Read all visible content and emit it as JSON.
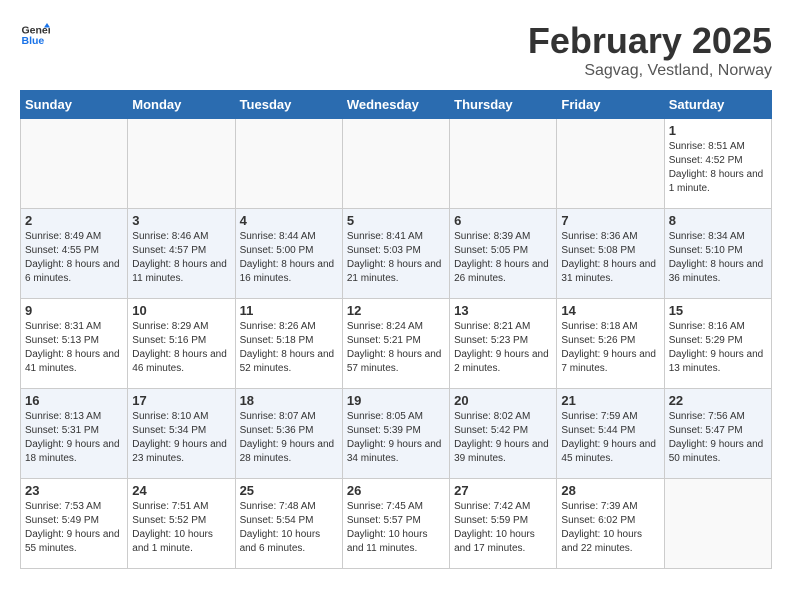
{
  "header": {
    "logo_general": "General",
    "logo_blue": "Blue",
    "title": "February 2025",
    "subtitle": "Sagvag, Vestland, Norway"
  },
  "days_of_week": [
    "Sunday",
    "Monday",
    "Tuesday",
    "Wednesday",
    "Thursday",
    "Friday",
    "Saturday"
  ],
  "weeks": [
    [
      {
        "day": "",
        "info": "",
        "empty": true
      },
      {
        "day": "",
        "info": "",
        "empty": true
      },
      {
        "day": "",
        "info": "",
        "empty": true
      },
      {
        "day": "",
        "info": "",
        "empty": true
      },
      {
        "day": "",
        "info": "",
        "empty": true
      },
      {
        "day": "",
        "info": "",
        "empty": true
      },
      {
        "day": "1",
        "info": "Sunrise: 8:51 AM\nSunset: 4:52 PM\nDaylight: 8 hours and 1 minute.",
        "empty": false
      }
    ],
    [
      {
        "day": "2",
        "info": "Sunrise: 8:49 AM\nSunset: 4:55 PM\nDaylight: 8 hours and 6 minutes.",
        "empty": false
      },
      {
        "day": "3",
        "info": "Sunrise: 8:46 AM\nSunset: 4:57 PM\nDaylight: 8 hours and 11 minutes.",
        "empty": false
      },
      {
        "day": "4",
        "info": "Sunrise: 8:44 AM\nSunset: 5:00 PM\nDaylight: 8 hours and 16 minutes.",
        "empty": false
      },
      {
        "day": "5",
        "info": "Sunrise: 8:41 AM\nSunset: 5:03 PM\nDaylight: 8 hours and 21 minutes.",
        "empty": false
      },
      {
        "day": "6",
        "info": "Sunrise: 8:39 AM\nSunset: 5:05 PM\nDaylight: 8 hours and 26 minutes.",
        "empty": false
      },
      {
        "day": "7",
        "info": "Sunrise: 8:36 AM\nSunset: 5:08 PM\nDaylight: 8 hours and 31 minutes.",
        "empty": false
      },
      {
        "day": "8",
        "info": "Sunrise: 8:34 AM\nSunset: 5:10 PM\nDaylight: 8 hours and 36 minutes.",
        "empty": false
      }
    ],
    [
      {
        "day": "9",
        "info": "Sunrise: 8:31 AM\nSunset: 5:13 PM\nDaylight: 8 hours and 41 minutes.",
        "empty": false
      },
      {
        "day": "10",
        "info": "Sunrise: 8:29 AM\nSunset: 5:16 PM\nDaylight: 8 hours and 46 minutes.",
        "empty": false
      },
      {
        "day": "11",
        "info": "Sunrise: 8:26 AM\nSunset: 5:18 PM\nDaylight: 8 hours and 52 minutes.",
        "empty": false
      },
      {
        "day": "12",
        "info": "Sunrise: 8:24 AM\nSunset: 5:21 PM\nDaylight: 8 hours and 57 minutes.",
        "empty": false
      },
      {
        "day": "13",
        "info": "Sunrise: 8:21 AM\nSunset: 5:23 PM\nDaylight: 9 hours and 2 minutes.",
        "empty": false
      },
      {
        "day": "14",
        "info": "Sunrise: 8:18 AM\nSunset: 5:26 PM\nDaylight: 9 hours and 7 minutes.",
        "empty": false
      },
      {
        "day": "15",
        "info": "Sunrise: 8:16 AM\nSunset: 5:29 PM\nDaylight: 9 hours and 13 minutes.",
        "empty": false
      }
    ],
    [
      {
        "day": "16",
        "info": "Sunrise: 8:13 AM\nSunset: 5:31 PM\nDaylight: 9 hours and 18 minutes.",
        "empty": false
      },
      {
        "day": "17",
        "info": "Sunrise: 8:10 AM\nSunset: 5:34 PM\nDaylight: 9 hours and 23 minutes.",
        "empty": false
      },
      {
        "day": "18",
        "info": "Sunrise: 8:07 AM\nSunset: 5:36 PM\nDaylight: 9 hours and 28 minutes.",
        "empty": false
      },
      {
        "day": "19",
        "info": "Sunrise: 8:05 AM\nSunset: 5:39 PM\nDaylight: 9 hours and 34 minutes.",
        "empty": false
      },
      {
        "day": "20",
        "info": "Sunrise: 8:02 AM\nSunset: 5:42 PM\nDaylight: 9 hours and 39 minutes.",
        "empty": false
      },
      {
        "day": "21",
        "info": "Sunrise: 7:59 AM\nSunset: 5:44 PM\nDaylight: 9 hours and 45 minutes.",
        "empty": false
      },
      {
        "day": "22",
        "info": "Sunrise: 7:56 AM\nSunset: 5:47 PM\nDaylight: 9 hours and 50 minutes.",
        "empty": false
      }
    ],
    [
      {
        "day": "23",
        "info": "Sunrise: 7:53 AM\nSunset: 5:49 PM\nDaylight: 9 hours and 55 minutes.",
        "empty": false
      },
      {
        "day": "24",
        "info": "Sunrise: 7:51 AM\nSunset: 5:52 PM\nDaylight: 10 hours and 1 minute.",
        "empty": false
      },
      {
        "day": "25",
        "info": "Sunrise: 7:48 AM\nSunset: 5:54 PM\nDaylight: 10 hours and 6 minutes.",
        "empty": false
      },
      {
        "day": "26",
        "info": "Sunrise: 7:45 AM\nSunset: 5:57 PM\nDaylight: 10 hours and 11 minutes.",
        "empty": false
      },
      {
        "day": "27",
        "info": "Sunrise: 7:42 AM\nSunset: 5:59 PM\nDaylight: 10 hours and 17 minutes.",
        "empty": false
      },
      {
        "day": "28",
        "info": "Sunrise: 7:39 AM\nSunset: 6:02 PM\nDaylight: 10 hours and 22 minutes.",
        "empty": false
      },
      {
        "day": "",
        "info": "",
        "empty": true
      }
    ]
  ]
}
